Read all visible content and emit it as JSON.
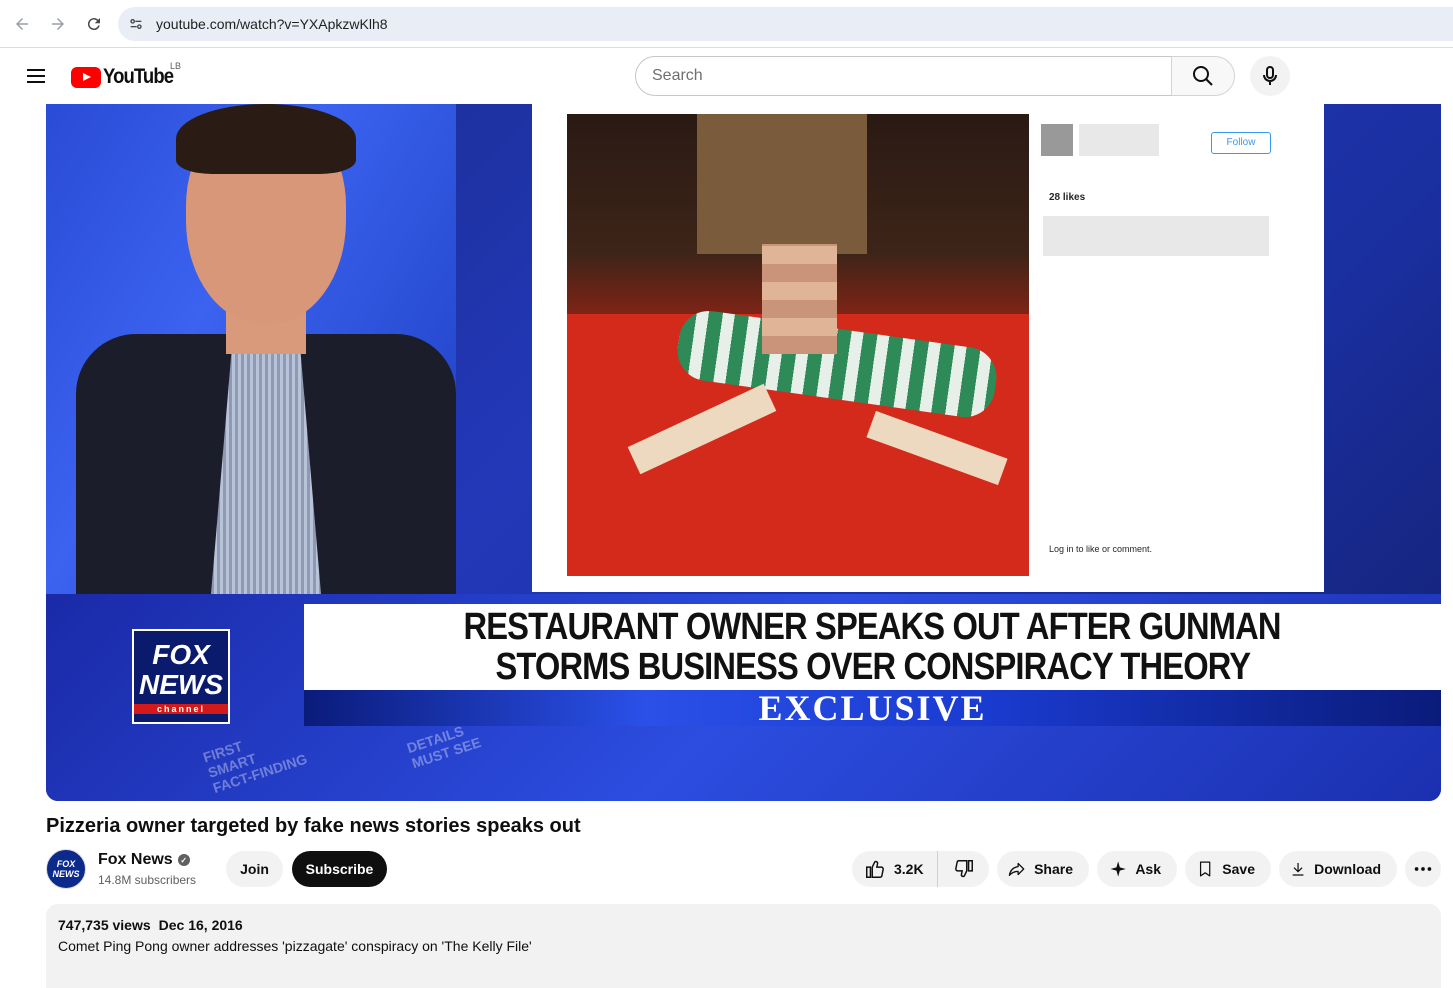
{
  "browser": {
    "url": "youtube.com/watch?v=YXApkzwKlh8"
  },
  "header": {
    "logo_text": "YouTube",
    "country_code": "LB",
    "search_placeholder": "Search"
  },
  "video": {
    "headline_line1": "RESTAURANT OWNER SPEAKS OUT AFTER GUNMAN",
    "headline_line2": "STORMS BUSINESS OVER CONSPIRACY THEORY",
    "banner": "EXCLUSIVE",
    "network_logo_line1": "FOX",
    "network_logo_line2": "NEWS",
    "network_logo_line3": "channel",
    "bg_text_1": "FIRST\nSMART\nFACT-FINDING",
    "bg_text_2": "DETAILS\nMUST SEE",
    "insta_follow": "Follow",
    "insta_likes": "28 likes",
    "insta_login": "Log in to like or comment."
  },
  "title": "Pizzeria owner targeted by fake news stories speaks out",
  "channel": {
    "name": "Fox News",
    "subscribers": "14.8M subscribers",
    "avatar_text": "FOX NEWS"
  },
  "actions": {
    "join": "Join",
    "subscribe": "Subscribe",
    "likes": "3.2K",
    "share": "Share",
    "ask": "Ask",
    "save": "Save",
    "download": "Download"
  },
  "description": {
    "views": "747,735 views",
    "date": "Dec 16, 2016",
    "text": "Comet Ping Pong owner addresses 'pizzagate' conspiracy on 'The Kelly File'"
  }
}
